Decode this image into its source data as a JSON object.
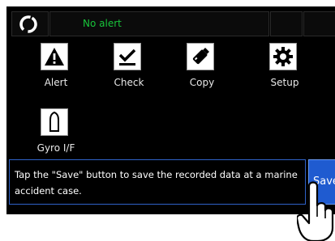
{
  "status_bar": {
    "busy_icon": "loading-ring-icon",
    "alert_text": "No alert"
  },
  "menu": {
    "items": [
      {
        "label": "Alert",
        "icon": "warning-triangle-icon"
      },
      {
        "label": "Check",
        "icon": "checkmark-icon"
      },
      {
        "label": "Copy",
        "icon": "usb-drive-icon"
      },
      {
        "label": "Setup",
        "icon": "gear-icon"
      },
      {
        "label": "Gyro I/F",
        "icon": "gyro-bow-icon"
      }
    ]
  },
  "message": {
    "text": "Tap the \"Save\" button to save the recorded data at a marine accident case."
  },
  "save_button": {
    "label": "Save"
  },
  "colors": {
    "background": "#000000",
    "alert_text": "#18c43a",
    "accent_blue": "#1f5bd0",
    "message_border": "#2f62c8"
  },
  "pointer_icon": "tapping-hand-icon"
}
